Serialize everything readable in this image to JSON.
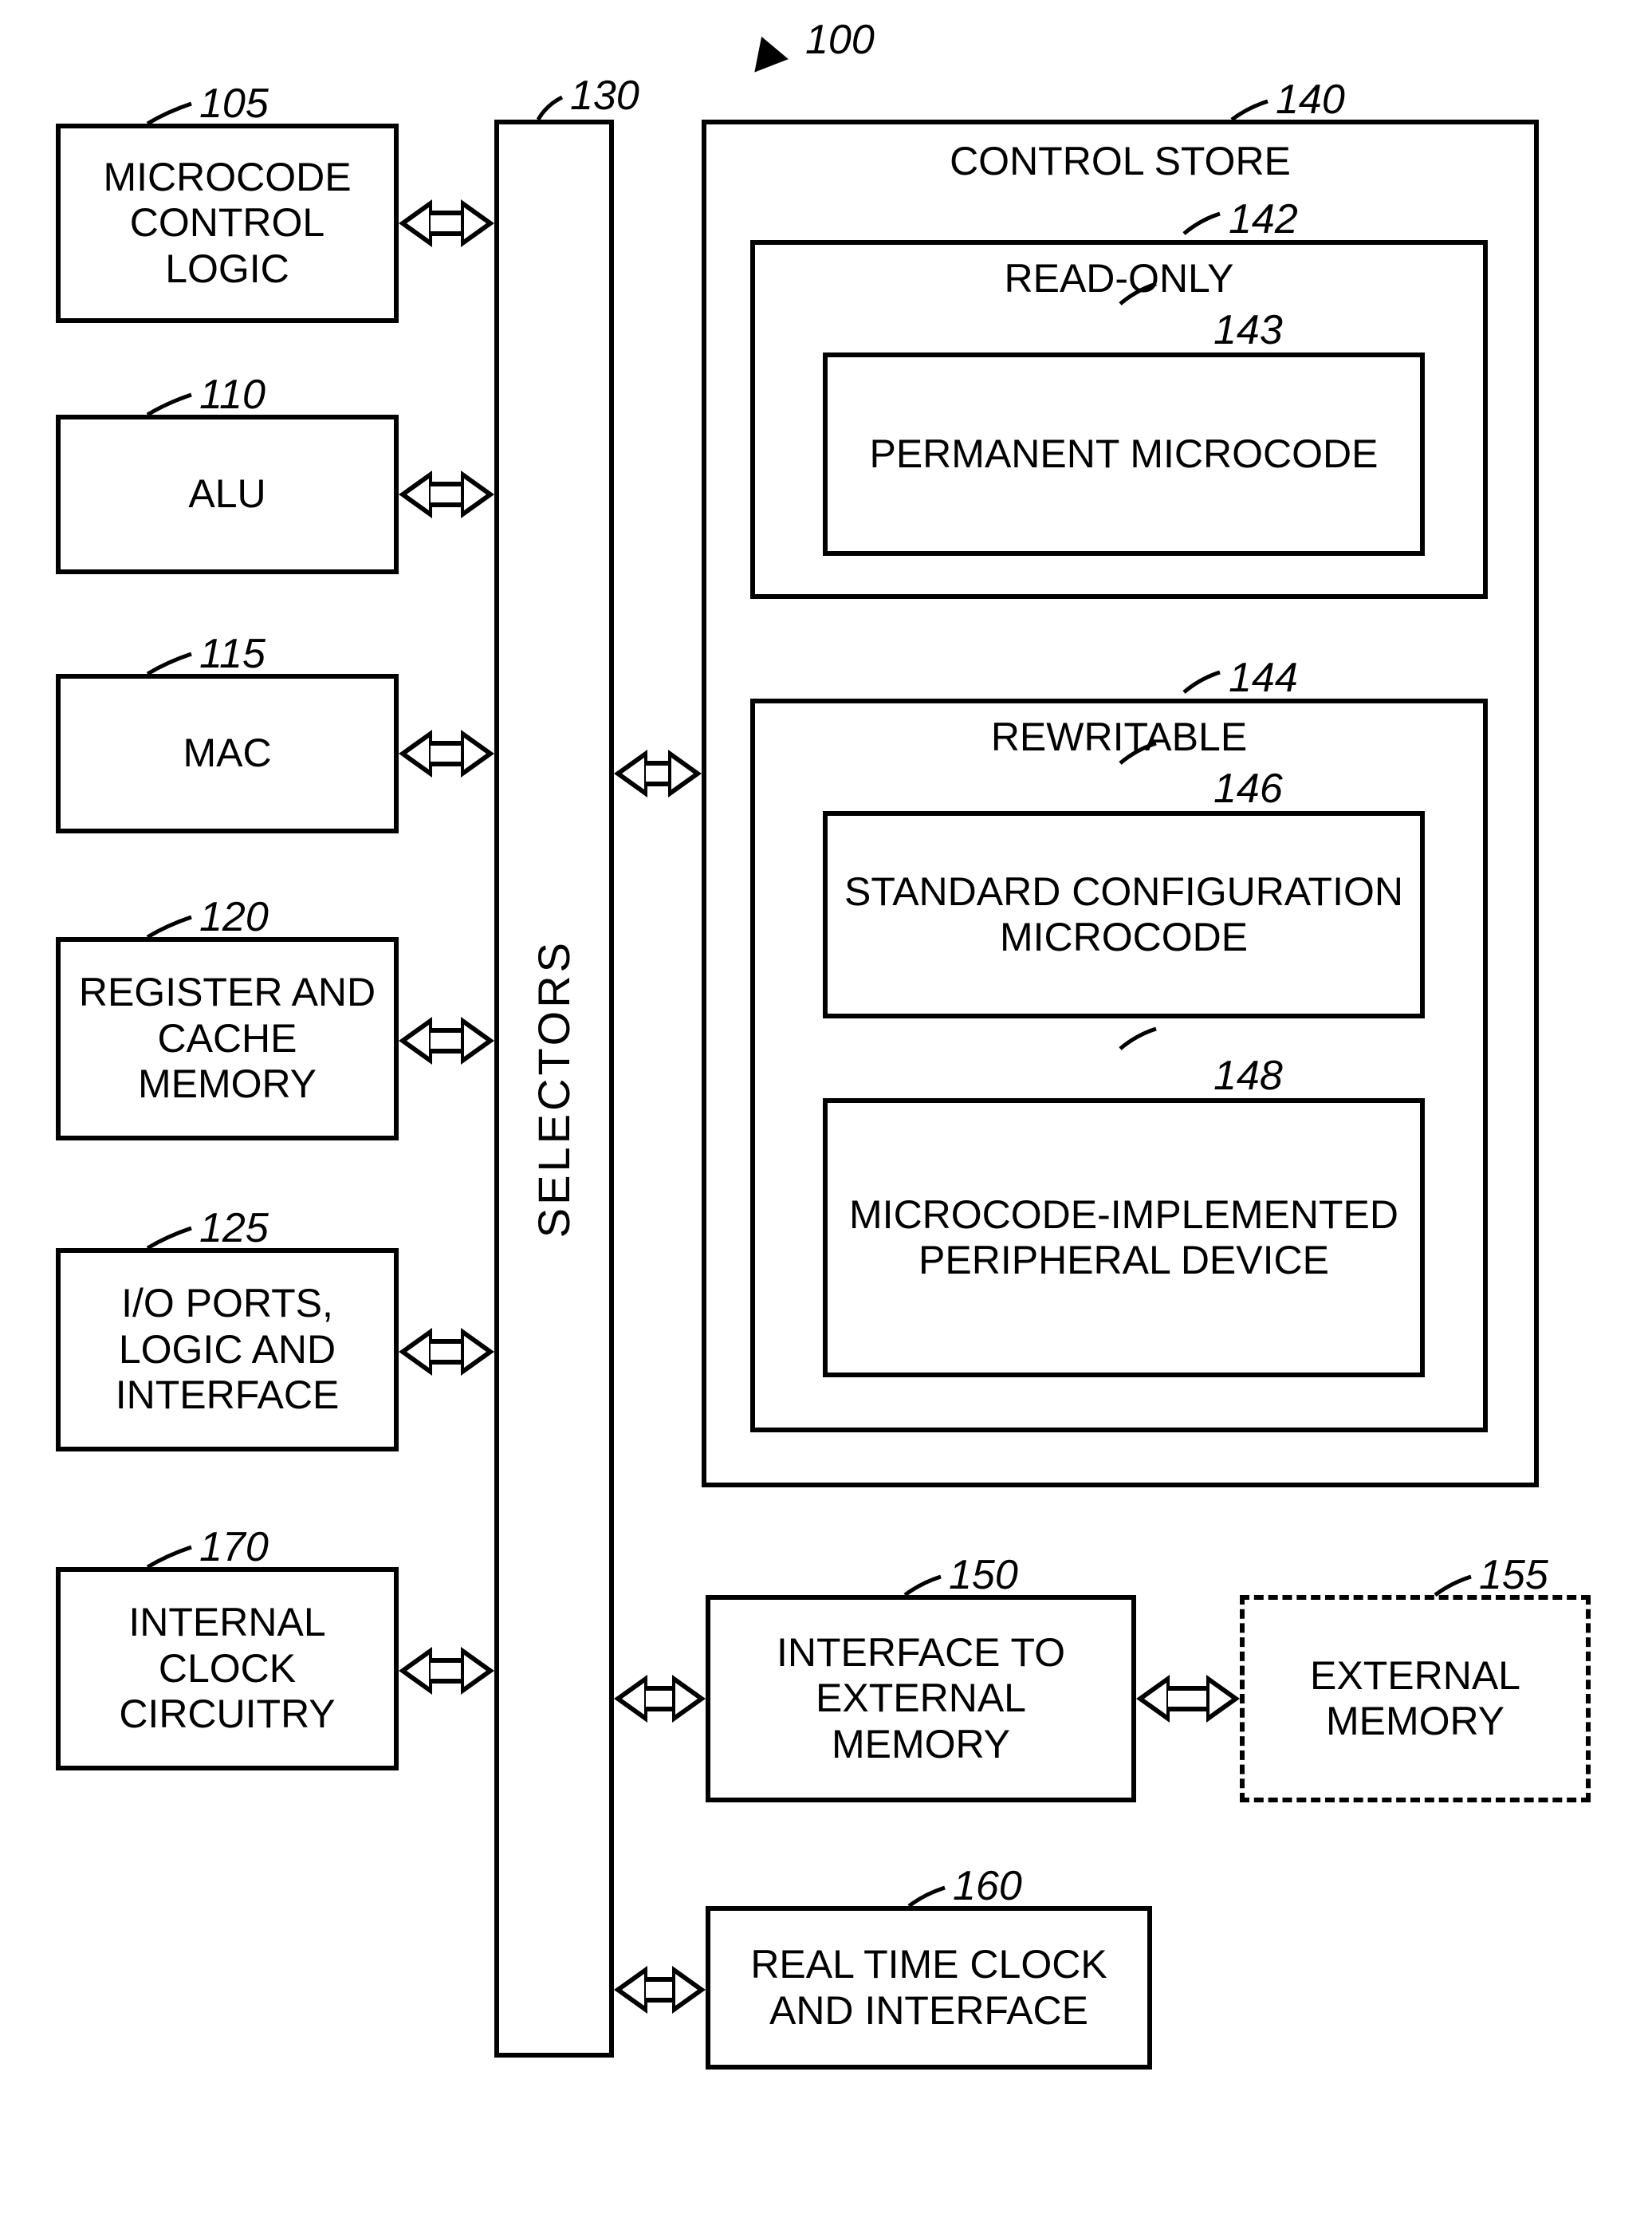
{
  "figure_ref": "100",
  "selectors_label": "SELECTORS",
  "refs": {
    "b105": "105",
    "b110": "110",
    "b115": "115",
    "b120": "120",
    "b125": "125",
    "b130": "130",
    "b140": "140",
    "b142": "142",
    "b143": "143",
    "b144": "144",
    "b146": "146",
    "b148": "148",
    "b150": "150",
    "b155": "155",
    "b160": "160",
    "b170": "170"
  },
  "blocks": {
    "b105": "MICROCODE CONTROL LOGIC",
    "b110": "ALU",
    "b115": "MAC",
    "b120": "REGISTER AND CACHE MEMORY",
    "b125": "I/O PORTS, LOGIC AND INTERFACE",
    "b170": "INTERNAL CLOCK CIRCUITRY",
    "b140": "CONTROL STORE",
    "b142": "READ-ONLY",
    "b143": "PERMANENT MICROCODE",
    "b144": "REWRITABLE",
    "b146": "STANDARD CONFIGURATION MICROCODE",
    "b148": "MICROCODE-IMPLEMENTED PERIPHERAL DEVICE",
    "b150": "INTERFACE TO EXTERNAL MEMORY",
    "b155": "EXTERNAL MEMORY",
    "b160": "REAL TIME CLOCK AND INTERFACE"
  }
}
